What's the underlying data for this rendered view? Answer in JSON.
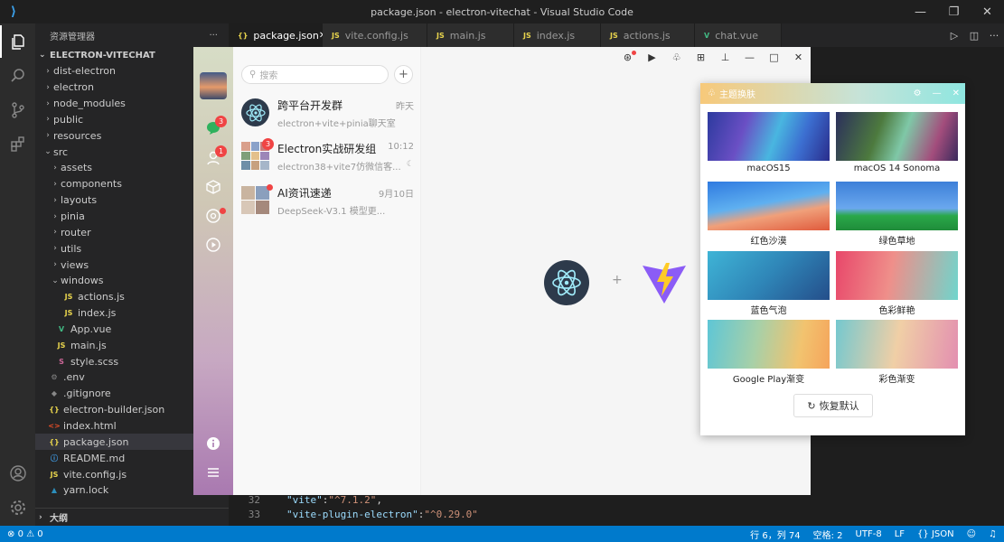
{
  "window": {
    "title": "package.json - electron-vitechat - Visual Studio Code"
  },
  "explorer": {
    "header": "资源管理器",
    "project": "ELECTRON-VITECHAT",
    "items": [
      {
        "label": "dist-electron",
        "type": "folder"
      },
      {
        "label": "electron",
        "type": "folder"
      },
      {
        "label": "node_modules",
        "type": "folder"
      },
      {
        "label": "public",
        "type": "folder"
      },
      {
        "label": "resources",
        "type": "folder"
      },
      {
        "label": "src",
        "type": "folder-open"
      },
      {
        "label": "assets",
        "type": "folder"
      },
      {
        "label": "components",
        "type": "folder"
      },
      {
        "label": "layouts",
        "type": "folder"
      },
      {
        "label": "pinia",
        "type": "folder"
      },
      {
        "label": "router",
        "type": "folder"
      },
      {
        "label": "utils",
        "type": "folder"
      },
      {
        "label": "views",
        "type": "folder"
      },
      {
        "label": "windows",
        "type": "folder-open"
      },
      {
        "label": "actions.js",
        "type": "js"
      },
      {
        "label": "index.js",
        "type": "js"
      },
      {
        "label": "App.vue",
        "type": "vue"
      },
      {
        "label": "main.js",
        "type": "js"
      },
      {
        "label": "style.scss",
        "type": "scss"
      },
      {
        "label": ".env",
        "type": "env"
      },
      {
        "label": ".gitignore",
        "type": "git"
      },
      {
        "label": "electron-builder.json",
        "type": "json"
      },
      {
        "label": "index.html",
        "type": "html"
      },
      {
        "label": "package.json",
        "type": "json"
      },
      {
        "label": "README.md",
        "type": "md"
      },
      {
        "label": "vite.config.js",
        "type": "js"
      },
      {
        "label": "yarn.lock",
        "type": "yarn"
      }
    ],
    "outline": "大纲"
  },
  "tabs": [
    {
      "label": "package.json",
      "icon": "{}"
    },
    {
      "label": "vite.config.js",
      "icon": "JS"
    },
    {
      "label": "main.js",
      "icon": "JS"
    },
    {
      "label": "index.js",
      "icon": "JS"
    },
    {
      "label": "actions.js",
      "icon": "JS"
    },
    {
      "label": "chat.vue",
      "icon": "V"
    }
  ],
  "code": [
    {
      "line": "32",
      "key": "\"vite\"",
      "value": "\"^7.1.2\""
    },
    {
      "line": "33",
      "key": "\"vite-plugin-electron\"",
      "value": "\"^0.29.0\""
    }
  ],
  "status": {
    "errors": "0",
    "warnings": "0",
    "position": "行 6，列 74",
    "spaces": "空格: 2",
    "encoding": "UTF-8",
    "eol": "LF",
    "language": "JSON"
  },
  "chat": {
    "search_placeholder": "搜索",
    "conversations": [
      {
        "name": "跨平台开发群",
        "time": "昨天",
        "preview": "electron+vite+pinia聊天室",
        "badge": ""
      },
      {
        "name": "Electron实战研发组",
        "time": "10:12",
        "preview": "electron38+vite7仿微信客...",
        "badge": "3"
      },
      {
        "name": "AI资讯速递",
        "time": "9月10日",
        "preview": "DeepSeek-V3.1 模型更...",
        "badge": "dot"
      }
    ],
    "rail_badges": {
      "chat": "3",
      "contacts": "1"
    },
    "center_plus": "+"
  },
  "theme_panel": {
    "title": "主题换肤",
    "themes": [
      {
        "label": "macOS15"
      },
      {
        "label": "macOS 14 Sonoma"
      },
      {
        "label": "红色沙漠"
      },
      {
        "label": "绿色草地"
      },
      {
        "label": "蓝色气泡"
      },
      {
        "label": "色彩鲜艳"
      },
      {
        "label": "Google Play渐变"
      },
      {
        "label": "彩色渐变"
      }
    ],
    "reset_label": "恢复默认"
  },
  "colors": {
    "statusbar": "#007acc",
    "accent": "#f04444"
  }
}
